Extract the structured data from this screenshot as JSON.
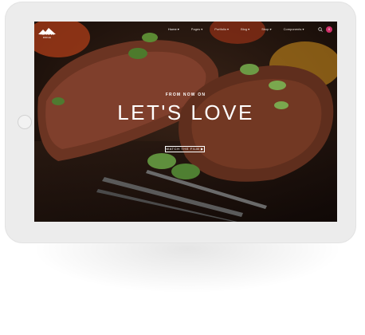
{
  "logo": {
    "text": "THE ASPEN RIDGE"
  },
  "nav": {
    "items": [
      {
        "label": "Home ▾",
        "active": true
      },
      {
        "label": "Pages ▾",
        "active": false
      },
      {
        "label": "Portfolio ▾",
        "active": false
      },
      {
        "label": "Blog ▾",
        "active": false
      },
      {
        "label": "Shop ▾",
        "active": false
      },
      {
        "label": "Components ▾",
        "active": false
      }
    ],
    "cart_count": "0"
  },
  "hero": {
    "subtitle": "FROM NOW ON",
    "title": "LET'S LOVE",
    "button_label": "WATCH THE FILM ▶"
  },
  "colors": {
    "accent": "#d0306a",
    "device_frame": "#ececec"
  }
}
